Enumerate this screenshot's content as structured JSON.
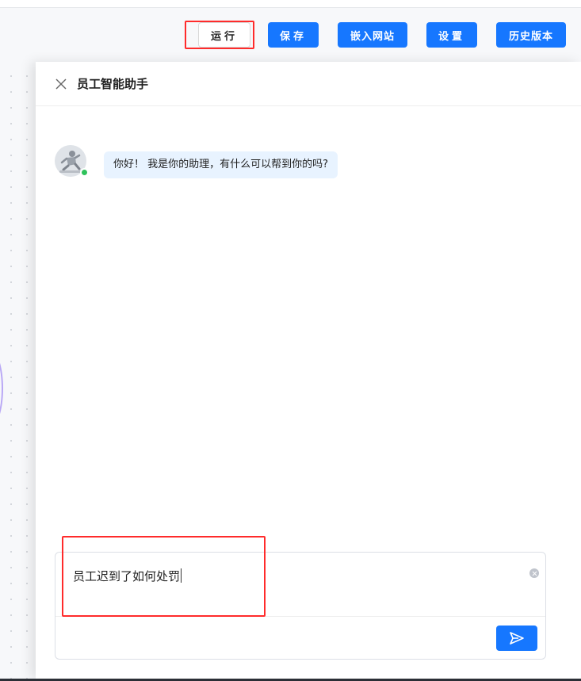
{
  "toolbar": {
    "run_label": "运行",
    "save_label": "保存",
    "embed_label": "嵌入网站",
    "settings_label": "设置",
    "history_label": "历史版本"
  },
  "chat_panel": {
    "title": "员工智能助手",
    "messages": [
      {
        "role": "assistant",
        "text": "你好！ 我是你的助理，有什么可以帮到你的吗?",
        "status": "online"
      }
    ],
    "input": {
      "value": "员工迟到了如何处罚"
    }
  },
  "colors": {
    "primary": "#1677ff",
    "highlight": "#ff2b2b",
    "online": "#2fc25b",
    "bubble_bg": "#e8f3ff"
  },
  "icons": {
    "close": "close-icon",
    "send": "send-icon",
    "clear": "clear-icon"
  }
}
